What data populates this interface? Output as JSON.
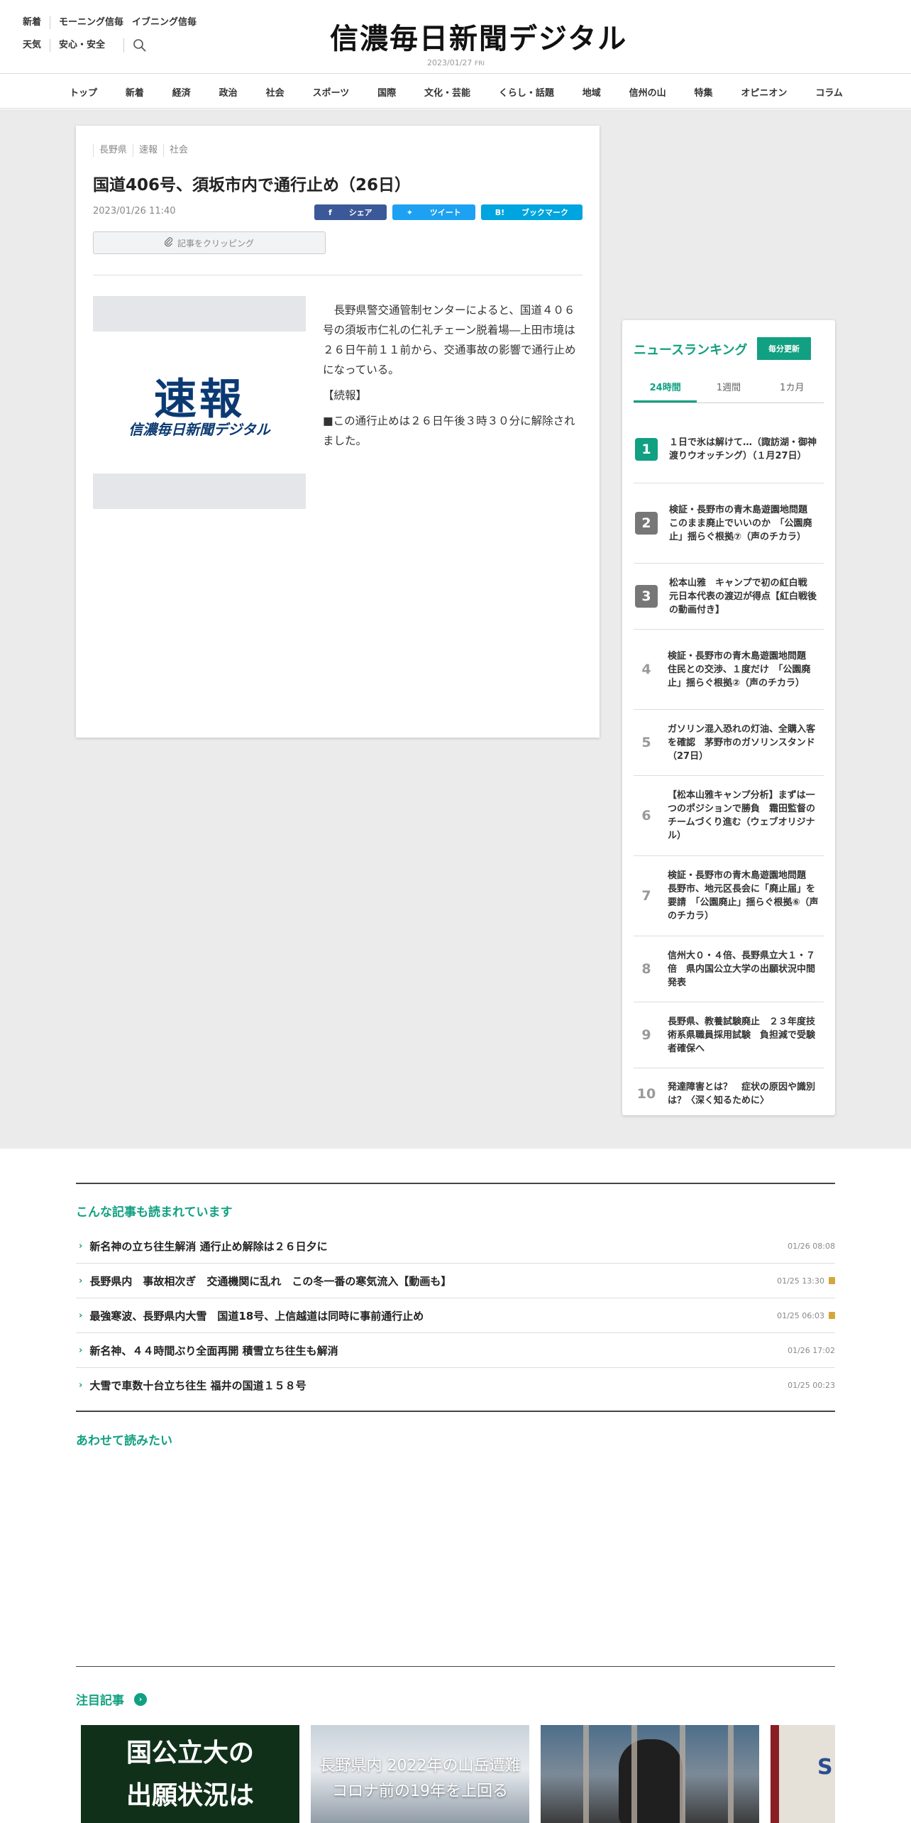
{
  "header": {
    "links_row1": [
      "新着",
      "モーニング信毎",
      "イブニング信毎"
    ],
    "links_row2": [
      "天気",
      "安心・安全"
    ],
    "logo": "信濃毎日新聞デジタル",
    "date": "2023/01/27",
    "weekday": "FRI"
  },
  "nav": [
    "トップ",
    "新着",
    "経済",
    "政治",
    "社会",
    "スポーツ",
    "国際",
    "文化・芸能",
    "くらし・話題",
    "地域",
    "信州の山",
    "特集",
    "オピニオン",
    "コラム"
  ],
  "article": {
    "tags": [
      "長野県",
      "速報",
      "社会"
    ],
    "title": "国道406号、須坂市内で通行止め（26日）",
    "datetime": "2023/01/26 11:40",
    "share_fb": "シェア",
    "share_tw": "ツイート",
    "share_hb": "ブックマーク",
    "clip_label": "記事をクリッピング",
    "photo_big": "速報",
    "photo_small": "信濃毎日新聞デジタル",
    "body": [
      "　長野県警交通管制センターによると、国道４０６号の須坂市仁礼の仁礼チェーン脱着場―上田市境は２６日午前１１前から、交通事故の影響で通行止めになっている。",
      "【続報】",
      "■この通行止めは２６日午後３時３０分に解除されました。"
    ]
  },
  "ranking": {
    "title": "ニュースランキング",
    "badge": "毎分更新",
    "tabs": [
      "24時間",
      "1週間",
      "1カ月"
    ],
    "items": [
      {
        "rank": "1",
        "text": "１日で氷は解けて…（諏訪湖・御神渡りウオッチング）（１月27日）"
      },
      {
        "rank": "2",
        "text": "検証・長野市の青木島遊園地問題　このまま廃止でいいのか　「公園廃止」揺らぐ根拠⑦（声のチカラ）"
      },
      {
        "rank": "3",
        "text": "松本山雅　キャンプで初の紅白戦　元日本代表の渡辺が得点【紅白戦後の動画付き】"
      },
      {
        "rank": "4",
        "text": "検証・長野市の青木島遊園地問題　住民との交渉、１度だけ　「公園廃止」揺らぐ根拠②（声のチカラ）"
      },
      {
        "rank": "5",
        "text": "ガソリン混入恐れの灯油、全購入客を確認　茅野市のガソリンスタンド（27日）"
      },
      {
        "rank": "6",
        "text": "【松本山雅キャンプ分析】まずは一つのポジションで勝負　霜田監督のチームづくり進む（ウェブオリジナル）"
      },
      {
        "rank": "7",
        "text": "検証・長野市の青木島遊園地問題　長野市、地元区長会に「廃止届」を要請　「公園廃止」揺らぐ根拠⑥（声のチカラ）"
      },
      {
        "rank": "8",
        "text": "信州大０・４倍、長野県立大１・７倍　県内国公立大学の出願状況中間発表"
      },
      {
        "rank": "9",
        "text": "長野県、教養試験廃止　２３年度技術系県職員採用試験　負担減で受験者確保へ"
      },
      {
        "rank": "10",
        "text": "発達障害とは？　症状の原因や識別は？〈深く知るために〉"
      }
    ]
  },
  "related": {
    "title": "こんな記事も読まれています",
    "items": [
      {
        "text": "新名神の立ち往生解消 通行止め解除は２６日夕に",
        "date": "01/26 08:08",
        "locked": false
      },
      {
        "text": "長野県内　事故相次ぎ　交通機関に乱れ　この冬一番の寒気流入【動画も】",
        "date": "01/25 13:30",
        "locked": true
      },
      {
        "text": "最強寒波、長野県内大雪　国道18号、上信越道は同時に事前通行止め",
        "date": "01/25 06:03",
        "locked": true
      },
      {
        "text": "新名神、４４時間ぶり全面再開 積雪立ち往生も解消",
        "date": "01/26 17:02",
        "locked": false
      },
      {
        "text": "大雪で車数十台立ち往生 福井の国道１５８号",
        "date": "01/25 00:23",
        "locked": false
      }
    ]
  },
  "also_read": {
    "title": "あわせて読みたい"
  },
  "featured": {
    "title": "注目記事",
    "card1": [
      "国公立大の",
      "出願状況は"
    ],
    "card2": [
      "長野県内 2022年の山岳遭難",
      "コロナ前の19年を上回る"
    ],
    "card4": "S"
  },
  "colors": {
    "accent": "#11a081",
    "facebook": "#3b5998",
    "twitter": "#1da1f2",
    "hatena": "#00a4de",
    "brand_blue": "#0b3a73"
  }
}
